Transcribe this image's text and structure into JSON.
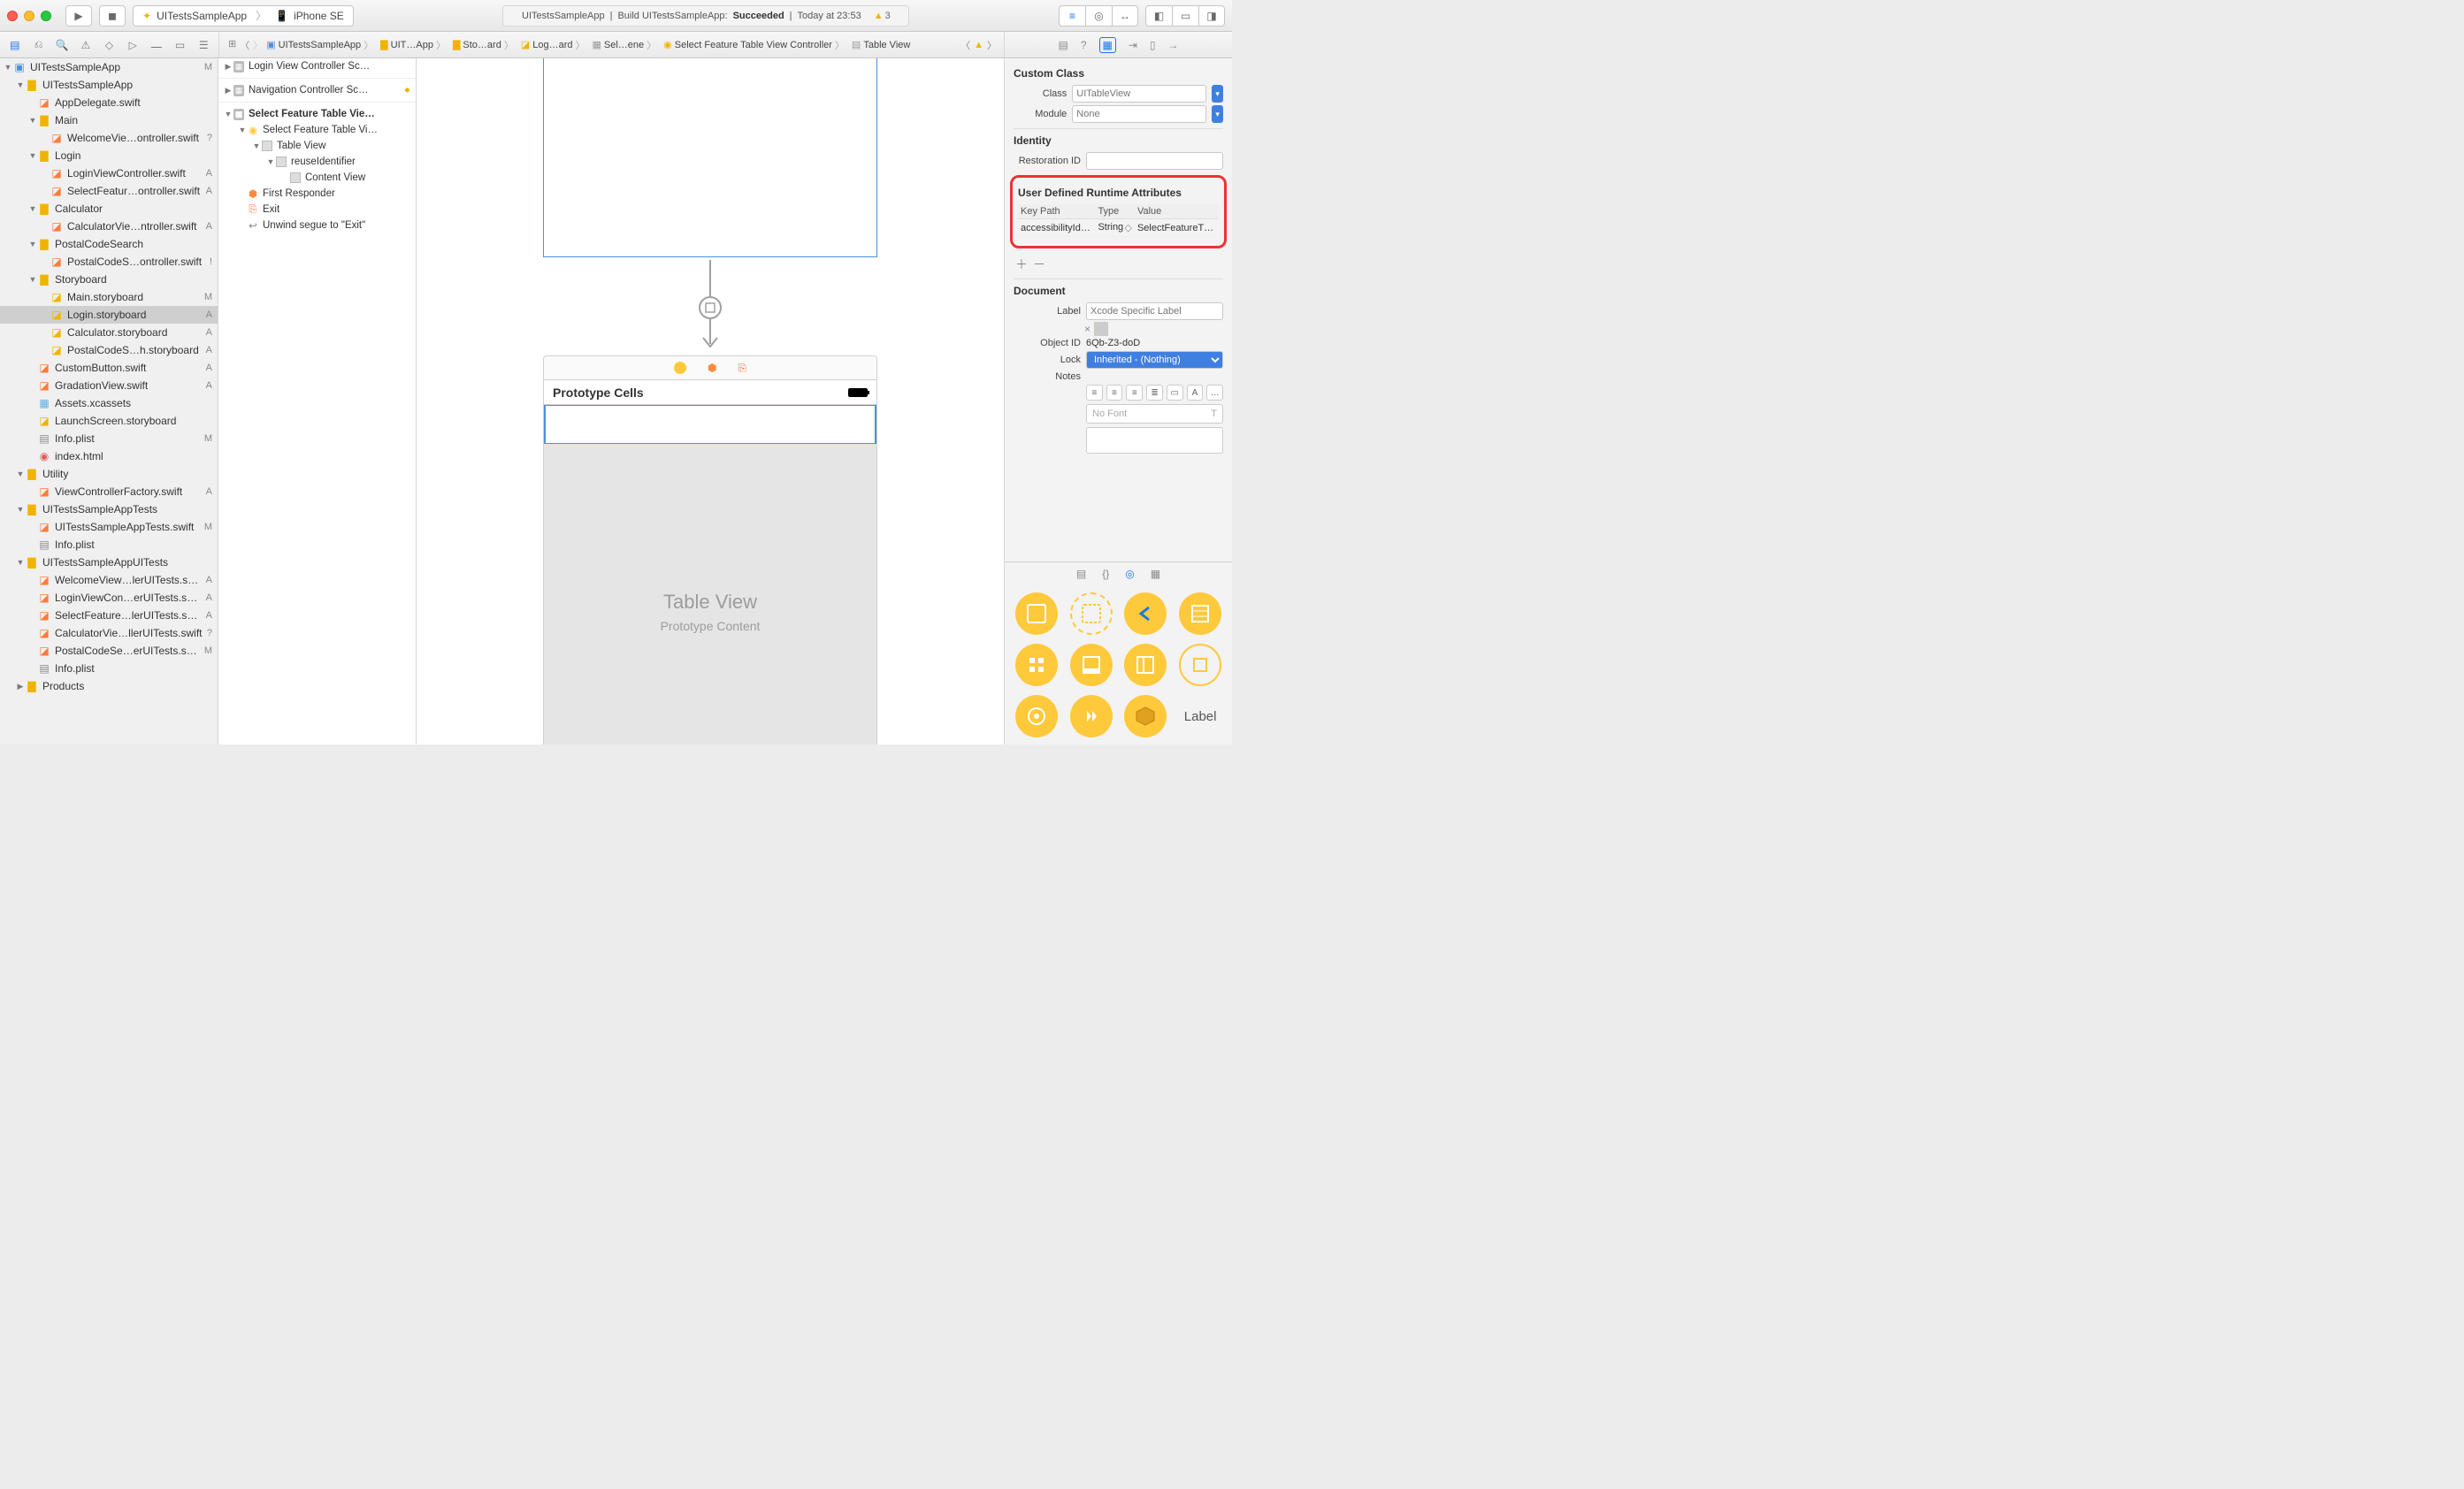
{
  "titlebar": {
    "scheme_app": "UITestsSampleApp",
    "scheme_device": "iPhone SE",
    "status_app": "UITestsSampleApp",
    "status_action": "Build UITestsSampleApp:",
    "status_result": "Succeeded",
    "status_time": "Today at 23:53",
    "warn_count": "3"
  },
  "jumpbar": {
    "segs": [
      "UITestsSampleApp",
      "UIT…App",
      "Sto…ard",
      "Log…ard",
      "Sel…ene",
      "Select Feature Table View Controller",
      "Table View"
    ]
  },
  "navigator": {
    "rows": [
      {
        "ind": 0,
        "disc": "▼",
        "ic": "proj",
        "name": "UITestsSampleApp",
        "badge": "M"
      },
      {
        "ind": 1,
        "disc": "▼",
        "ic": "fold",
        "name": "UITestsSampleApp",
        "badge": ""
      },
      {
        "ind": 2,
        "disc": "",
        "ic": "swift",
        "name": "AppDelegate.swift",
        "badge": ""
      },
      {
        "ind": 2,
        "disc": "▼",
        "ic": "fold",
        "name": "Main",
        "badge": ""
      },
      {
        "ind": 3,
        "disc": "",
        "ic": "swift",
        "name": "WelcomeVie…ontroller.swift",
        "badge": "?"
      },
      {
        "ind": 2,
        "disc": "▼",
        "ic": "fold",
        "name": "Login",
        "badge": ""
      },
      {
        "ind": 3,
        "disc": "",
        "ic": "swift",
        "name": "LoginViewController.swift",
        "badge": "A"
      },
      {
        "ind": 3,
        "disc": "",
        "ic": "swift",
        "name": "SelectFeatur…ontroller.swift",
        "badge": "A"
      },
      {
        "ind": 2,
        "disc": "▼",
        "ic": "fold",
        "name": "Calculator",
        "badge": ""
      },
      {
        "ind": 3,
        "disc": "",
        "ic": "swift",
        "name": "CalculatorVie…ntroller.swift",
        "badge": "A"
      },
      {
        "ind": 2,
        "disc": "▼",
        "ic": "fold",
        "name": "PostalCodeSearch",
        "badge": ""
      },
      {
        "ind": 3,
        "disc": "",
        "ic": "swift",
        "name": "PostalCodeS…ontroller.swift",
        "badge": "!"
      },
      {
        "ind": 2,
        "disc": "▼",
        "ic": "fold",
        "name": "Storyboard",
        "badge": ""
      },
      {
        "ind": 3,
        "disc": "",
        "ic": "sb",
        "name": "Main.storyboard",
        "badge": "M"
      },
      {
        "ind": 3,
        "disc": "",
        "ic": "sb",
        "name": "Login.storyboard",
        "badge": "A",
        "sel": true
      },
      {
        "ind": 3,
        "disc": "",
        "ic": "sb",
        "name": "Calculator.storyboard",
        "badge": "A"
      },
      {
        "ind": 3,
        "disc": "",
        "ic": "sb",
        "name": "PostalCodeS…h.storyboard",
        "badge": "A"
      },
      {
        "ind": 2,
        "disc": "",
        "ic": "swift",
        "name": "CustomButton.swift",
        "badge": "A"
      },
      {
        "ind": 2,
        "disc": "",
        "ic": "swift",
        "name": "GradationView.swift",
        "badge": "A"
      },
      {
        "ind": 2,
        "disc": "",
        "ic": "assets",
        "name": "Assets.xcassets",
        "badge": ""
      },
      {
        "ind": 2,
        "disc": "",
        "ic": "sb",
        "name": "LaunchScreen.storyboard",
        "badge": ""
      },
      {
        "ind": 2,
        "disc": "",
        "ic": "plist",
        "name": "Info.plist",
        "badge": "M"
      },
      {
        "ind": 2,
        "disc": "",
        "ic": "html",
        "name": "index.html",
        "badge": ""
      },
      {
        "ind": 1,
        "disc": "▼",
        "ic": "fold",
        "name": "Utility",
        "badge": ""
      },
      {
        "ind": 2,
        "disc": "",
        "ic": "swift",
        "name": "ViewControllerFactory.swift",
        "badge": "A"
      },
      {
        "ind": 1,
        "disc": "▼",
        "ic": "fold",
        "name": "UITestsSampleAppTests",
        "badge": ""
      },
      {
        "ind": 2,
        "disc": "",
        "ic": "swift",
        "name": "UITestsSampleAppTests.swift",
        "badge": "M"
      },
      {
        "ind": 2,
        "disc": "",
        "ic": "plist",
        "name": "Info.plist",
        "badge": ""
      },
      {
        "ind": 1,
        "disc": "▼",
        "ic": "fold",
        "name": "UITestsSampleAppUITests",
        "badge": ""
      },
      {
        "ind": 2,
        "disc": "",
        "ic": "swift",
        "name": "WelcomeView…lerUITests.swift",
        "badge": "A"
      },
      {
        "ind": 2,
        "disc": "",
        "ic": "swift",
        "name": "LoginViewCon…erUITests.swift",
        "badge": "A"
      },
      {
        "ind": 2,
        "disc": "",
        "ic": "swift",
        "name": "SelectFeature…lerUITests.swift",
        "badge": "A"
      },
      {
        "ind": 2,
        "disc": "",
        "ic": "swift",
        "name": "CalculatorVie…llerUITests.swift",
        "badge": "?"
      },
      {
        "ind": 2,
        "disc": "",
        "ic": "swift",
        "name": "PostalCodeSe…erUITests.swift",
        "badge": "M"
      },
      {
        "ind": 2,
        "disc": "",
        "ic": "plist",
        "name": "Info.plist",
        "badge": ""
      },
      {
        "ind": 1,
        "disc": "▶",
        "ic": "fold",
        "name": "Products",
        "badge": ""
      }
    ]
  },
  "outline": {
    "rows": [
      {
        "ind": 0,
        "disc": "▶",
        "kind": "scene",
        "name": "Login View Controller Sc…"
      },
      {
        "sep": true
      },
      {
        "ind": 0,
        "disc": "▶",
        "kind": "scene",
        "name": "Navigation Controller Sc…",
        "warn": true
      },
      {
        "sep": true
      },
      {
        "ind": 0,
        "disc": "▼",
        "kind": "scene",
        "name": "Select Feature Table Vie…",
        "bold": true
      },
      {
        "ind": 1,
        "disc": "▼",
        "kind": "vc",
        "name": "Select Feature Table Vi…"
      },
      {
        "ind": 2,
        "disc": "▼",
        "kind": "view",
        "name": "Table View"
      },
      {
        "ind": 3,
        "disc": "▼",
        "kind": "view",
        "name": "reuseIdentifier"
      },
      {
        "ind": 4,
        "disc": "",
        "kind": "view",
        "name": "Content View"
      },
      {
        "ind": 1,
        "disc": "",
        "kind": "resp",
        "name": "First Responder"
      },
      {
        "ind": 1,
        "disc": "",
        "kind": "exit",
        "name": "Exit"
      },
      {
        "ind": 1,
        "disc": "",
        "kind": "segue",
        "name": "Unwind segue to \"Exit\""
      }
    ]
  },
  "canvas": {
    "proto_title": "Prototype Cells",
    "tv_title": "Table View",
    "tv_sub": "Prototype Content"
  },
  "inspector": {
    "custom_class_title": "Custom Class",
    "class_label": "Class",
    "class_value": "UITableView",
    "module_label": "Module",
    "module_value": "None",
    "identity_title": "Identity",
    "restoration_label": "Restoration ID",
    "runtime_title": "User Defined Runtime Attributes",
    "rt_headers": {
      "kp": "Key Path",
      "type": "Type",
      "val": "Value"
    },
    "rt_row": {
      "kp": "accessibilityId…",
      "type": "String",
      "val": "SelectFeatureT…"
    },
    "document_title": "Document",
    "label_label": "Label",
    "label_placeholder": "Xcode Specific Label",
    "swatches": [
      "#ff5252",
      "#ffb84a",
      "#ffe84a",
      "#80e05c",
      "#5cc5e0",
      "#5c8ce0",
      "#c080e0",
      "#d0d0d0"
    ],
    "objectid_label": "Object ID",
    "objectid_value": "6Qb-Z3-doD",
    "lock_label": "Lock",
    "lock_value": "Inherited - (Nothing)",
    "notes_label": "Notes",
    "nofont": "No Font"
  },
  "library": {
    "label_text": "Label"
  }
}
